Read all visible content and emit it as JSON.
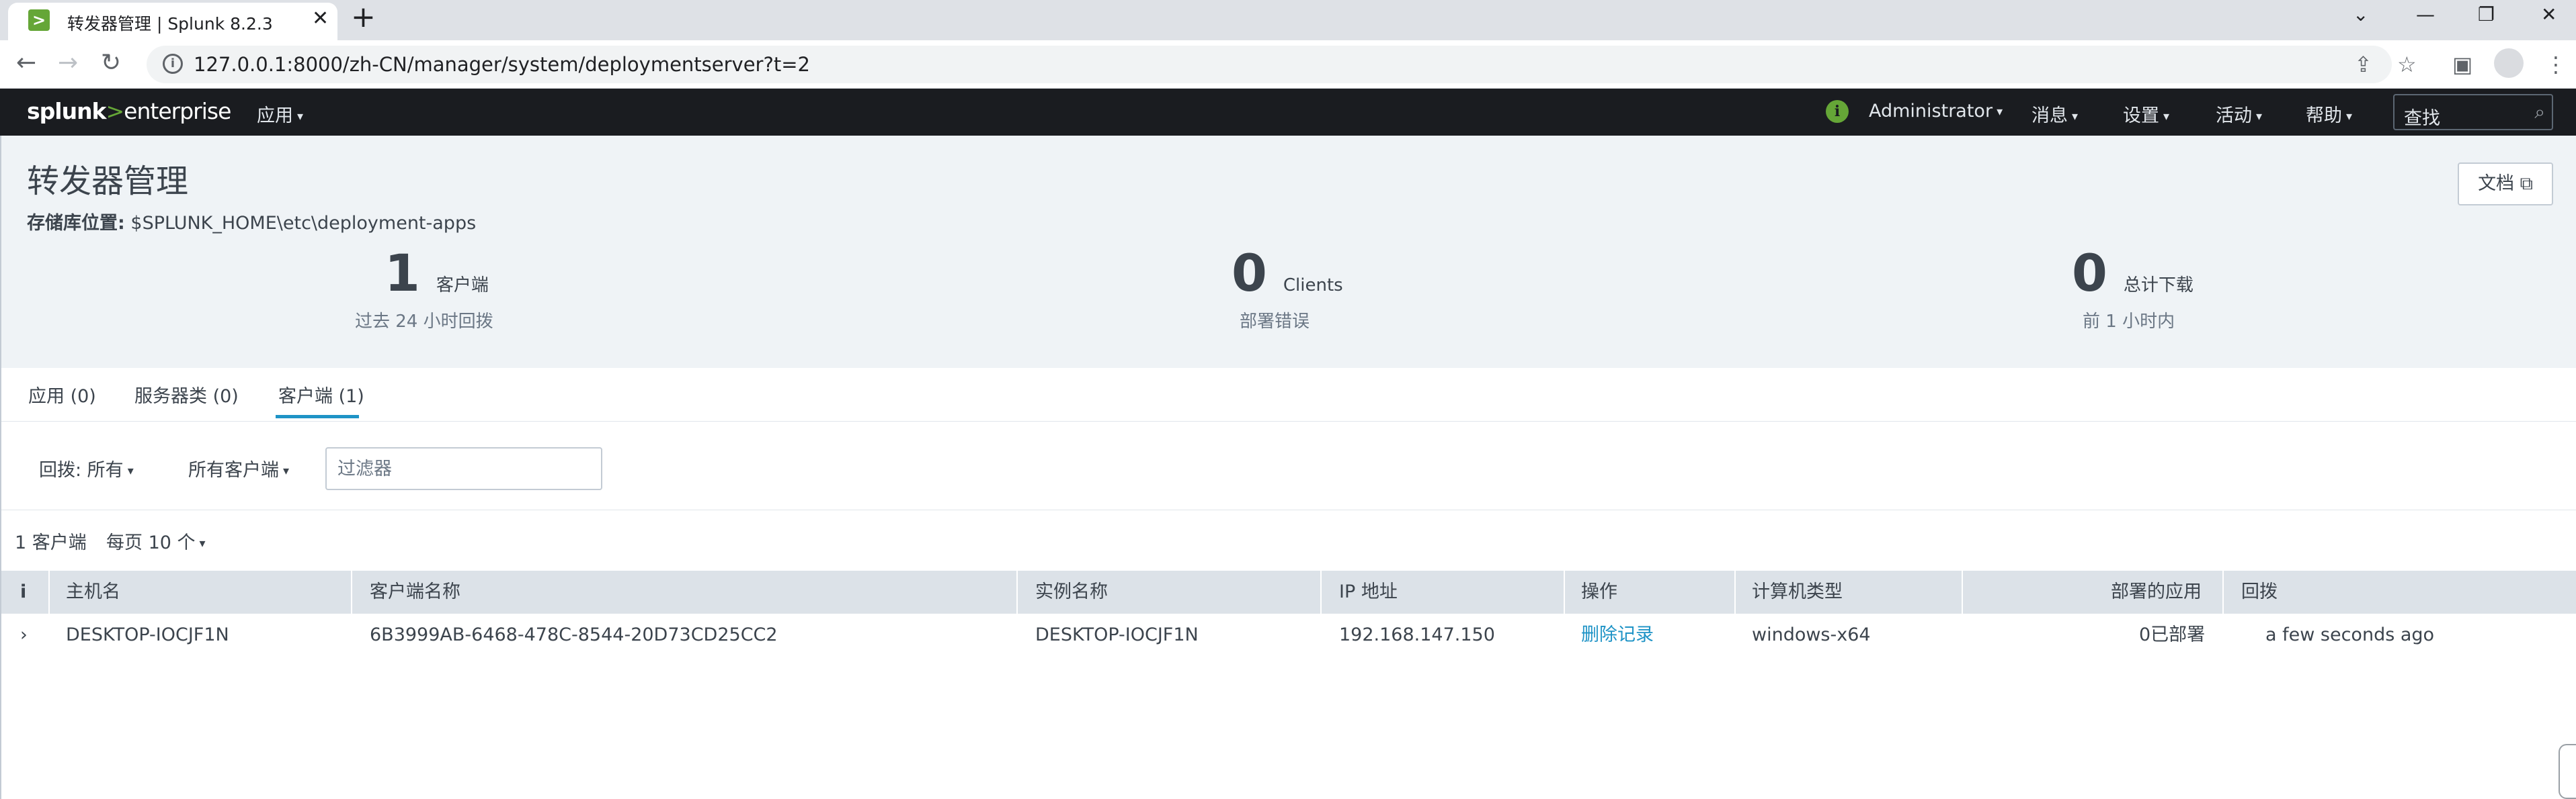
{
  "browser": {
    "tab_title": "转发器管理 | Splunk 8.2.3",
    "tab_close": "✕",
    "new_tab": "+",
    "url": "127.0.0.1:8000/zh-CN/manager/system/deploymentserver?t=2",
    "window_controls": {
      "minimize": "—",
      "restore": "❐",
      "close": "✕",
      "dropdown": "⌄"
    }
  },
  "splunkbar": {
    "logo_splunk": "splunk",
    "logo_gt": ">",
    "logo_enterprise": "enterprise",
    "apps_menu": "应用",
    "user_menu": "Administrator",
    "messages_menu": "消息",
    "settings_menu": "设置",
    "activity_menu": "活动",
    "help_menu": "帮助",
    "search_placeholder": "查找",
    "status_icon": "i"
  },
  "header": {
    "title": "转发器管理",
    "repo_label": "存储库位置:",
    "repo_path": "$SPLUNK_HOME\\etc\\deployment-apps",
    "docs_button": "文档 ⧉",
    "stats": [
      {
        "number": "1",
        "label": "客户端",
        "sub": "过去 24 小时回拨"
      },
      {
        "number": "0",
        "label": "Clients",
        "sub": "部署错误"
      },
      {
        "number": "0",
        "label": "总计下载",
        "sub": "前 1 小时内"
      }
    ]
  },
  "tabs": [
    {
      "label": "应用 (0)",
      "active": false
    },
    {
      "label": "服务器类 (0)",
      "active": false
    },
    {
      "label": "客户端 (1)",
      "active": true
    }
  ],
  "filters": {
    "phone_home": "回拨: 所有",
    "all_clients": "所有客户端",
    "filter_placeholder": "过滤器"
  },
  "list_info": {
    "count": "1 客户端",
    "per_page": "每页 10 个"
  },
  "table": {
    "columns": [
      "i",
      "主机名",
      "客户端名称",
      "实例名称",
      "IP 地址",
      "操作",
      "计算机类型",
      "部署的应用",
      "回拨"
    ],
    "rows": [
      {
        "expand": "›",
        "hostname": "DESKTOP-IOCJF1N",
        "client_name": "6B3999AB-6468-478C-8544-20D73CD25CC2",
        "instance_name": "DESKTOP-IOCJF1N",
        "ip": "192.168.147.150",
        "action": "删除记录",
        "machine_type": "windows-x64",
        "deployed_apps": "0已部署",
        "phone_home": "a few seconds ago"
      }
    ]
  },
  "colors": {
    "splunk_bar": "#1a1c20",
    "splunk_green": "#65a637",
    "header_bg": "#eff3f6",
    "link_blue": "#1e93c6",
    "table_header_bg": "#dce2e8"
  }
}
